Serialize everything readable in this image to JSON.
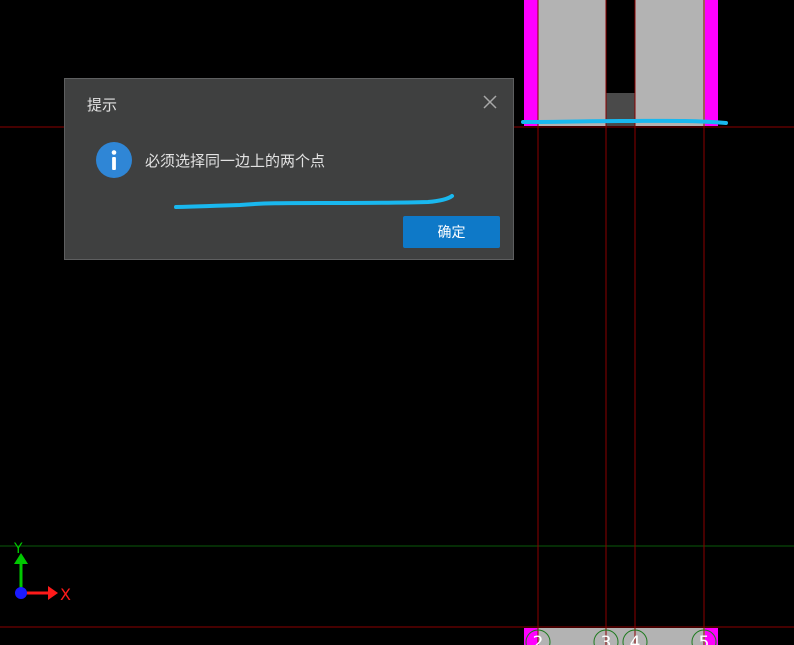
{
  "dialog": {
    "title": "提示",
    "message": "必须选择同一边上的两个点",
    "confirm_label": "确定",
    "icon": "info-icon",
    "close_icon": "close-icon"
  },
  "axis_indicator": {
    "y_label": "Y",
    "x_label": "X"
  },
  "grid_markers": [
    "2",
    "3",
    "4",
    "5"
  ],
  "colors": {
    "background": "#000000",
    "grid_line": "#8b0000",
    "horizontal_guide": "#0a5a0a",
    "column_fill": "#b3b3b3",
    "column_edge": "#ff00ff",
    "annotation_stroke": "#19b8ef",
    "dialog_bg": "#3f4040",
    "button": "#0e79c8",
    "axis_y": "#00c800",
    "axis_x": "#ff1a1a"
  }
}
